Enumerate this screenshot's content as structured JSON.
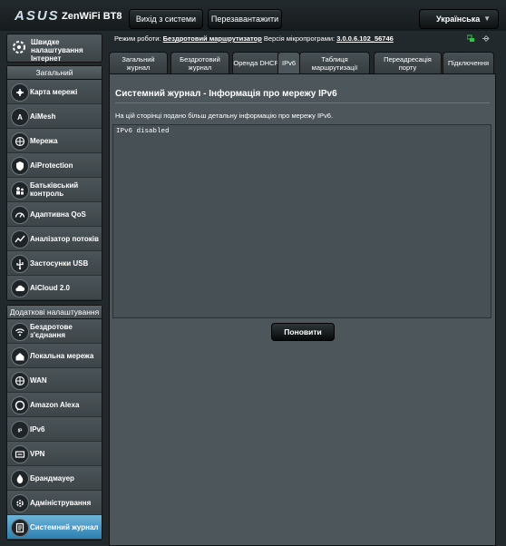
{
  "header": {
    "logo": "ASUS",
    "model": "ZenWiFi BT8",
    "logout": "Вихід з системи",
    "reboot": "Перезавантажити",
    "language": "Українська"
  },
  "sidebar": {
    "quick_setup": "Швидке налаштування Інтернет",
    "general_header": "Загальний",
    "general_items": [
      {
        "label": "Карта мережі",
        "icon": "network-map-icon"
      },
      {
        "label": "AiMesh",
        "icon": "aimesh-icon"
      },
      {
        "label": "Мережа",
        "icon": "globe-icon"
      },
      {
        "label": "AiProtection",
        "icon": "shield-icon"
      },
      {
        "label": "Батьківський контроль",
        "icon": "parental-icon"
      },
      {
        "label": "Адаптивна QoS",
        "icon": "speedometer-icon"
      },
      {
        "label": "Аналізатор потоків",
        "icon": "analyzer-icon"
      },
      {
        "label": "Застосунки USB",
        "icon": "usb-icon"
      },
      {
        "label": "AiCloud 2.0",
        "icon": "cloud-icon"
      }
    ],
    "advanced_header": "Додаткові налаштування",
    "advanced_items": [
      {
        "label": "Бездротове з'єднання",
        "icon": "wifi-icon"
      },
      {
        "label": "Локальна мережа",
        "icon": "home-icon"
      },
      {
        "label": "WAN",
        "icon": "globe-icon"
      },
      {
        "label": "Amazon Alexa",
        "icon": "alexa-icon"
      },
      {
        "label": "IPv6",
        "icon": "ipv6-icon"
      },
      {
        "label": "VPN",
        "icon": "vpn-icon"
      },
      {
        "label": "Брандмауер",
        "icon": "firewall-icon"
      },
      {
        "label": "Адміністрування",
        "icon": "admin-icon"
      },
      {
        "label": "Системний журнал",
        "icon": "log-icon",
        "active": true
      }
    ]
  },
  "status": {
    "mode_label": "Режим роботи:",
    "mode_value": "Бездротовий маршрутизатор",
    "fw_label": "Версія мікропрограми:",
    "fw_value": "3.0.0.6.102_56746"
  },
  "tabs": [
    {
      "label": "Загальний журнал"
    },
    {
      "label": "Бездротовий журнал"
    },
    {
      "label": "Оренда DHCP"
    },
    {
      "label": "IPv6",
      "active": true
    },
    {
      "label": "Таблиця маршрутизації"
    },
    {
      "label": "Переадресація порту"
    },
    {
      "label": "Підключення"
    }
  ],
  "panel": {
    "title": "Системний журнал - Інформація про мережу IPv6",
    "description": "На цій сторінці подано більш детальну інформацію про мережу IPv6.",
    "log": "IPv6 disabled",
    "refresh": "Поновити"
  },
  "colors": {
    "accent": "#2c7fb1",
    "status_green": "#35c24b"
  }
}
